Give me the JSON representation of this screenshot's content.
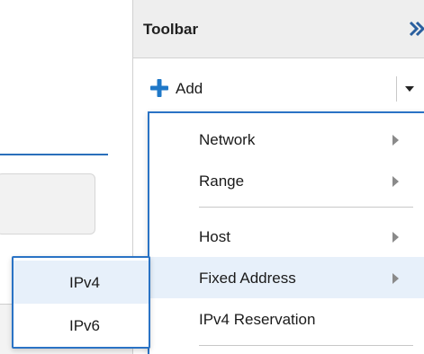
{
  "toolbar": {
    "title": "Toolbar",
    "add_label": "Add"
  },
  "add_menu": {
    "items": [
      {
        "label": "Network",
        "has_submenu": true
      },
      {
        "label": "Range",
        "has_submenu": true
      },
      {
        "label": "Host",
        "has_submenu": true
      },
      {
        "label": "Fixed Address",
        "has_submenu": true,
        "highlighted": true
      },
      {
        "label": "IPv4 Reservation",
        "has_submenu": false
      }
    ]
  },
  "ip_submenu": {
    "items": [
      {
        "label": "IPv4",
        "highlighted": true
      },
      {
        "label": "IPv6",
        "highlighted": false
      }
    ]
  },
  "colors": {
    "accent": "#2a73c5",
    "highlight": "#e7f0fa",
    "header_bg": "#eeeeee"
  },
  "icons": [
    "collapse-chevrons-icon",
    "plus-icon",
    "chevron-down-icon",
    "chevron-right-icon"
  ]
}
